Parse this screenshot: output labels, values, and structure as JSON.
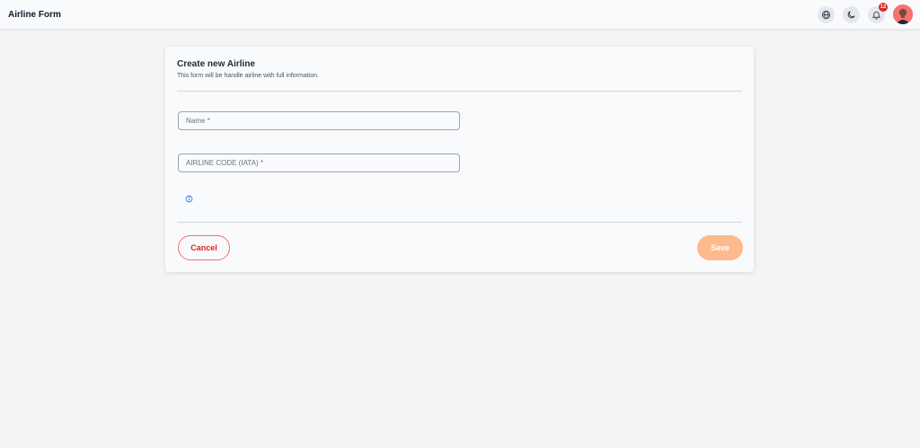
{
  "header": {
    "title": "Airline Form",
    "notification_count": "12",
    "icons": [
      "globe-icon",
      "moon-icon",
      "bell-icon"
    ]
  },
  "form": {
    "title": "Create new Airline",
    "subtitle": "This form will be handle airline with full information.",
    "name_placeholder": "Name *",
    "code_placeholder": "AIRLINE CODE (IATA) *",
    "cancel_label": "Cancel",
    "save_label": "Save"
  },
  "colors": {
    "accent": "#fdba8c",
    "danger": "#dc2626",
    "info": "#3b82f6"
  }
}
